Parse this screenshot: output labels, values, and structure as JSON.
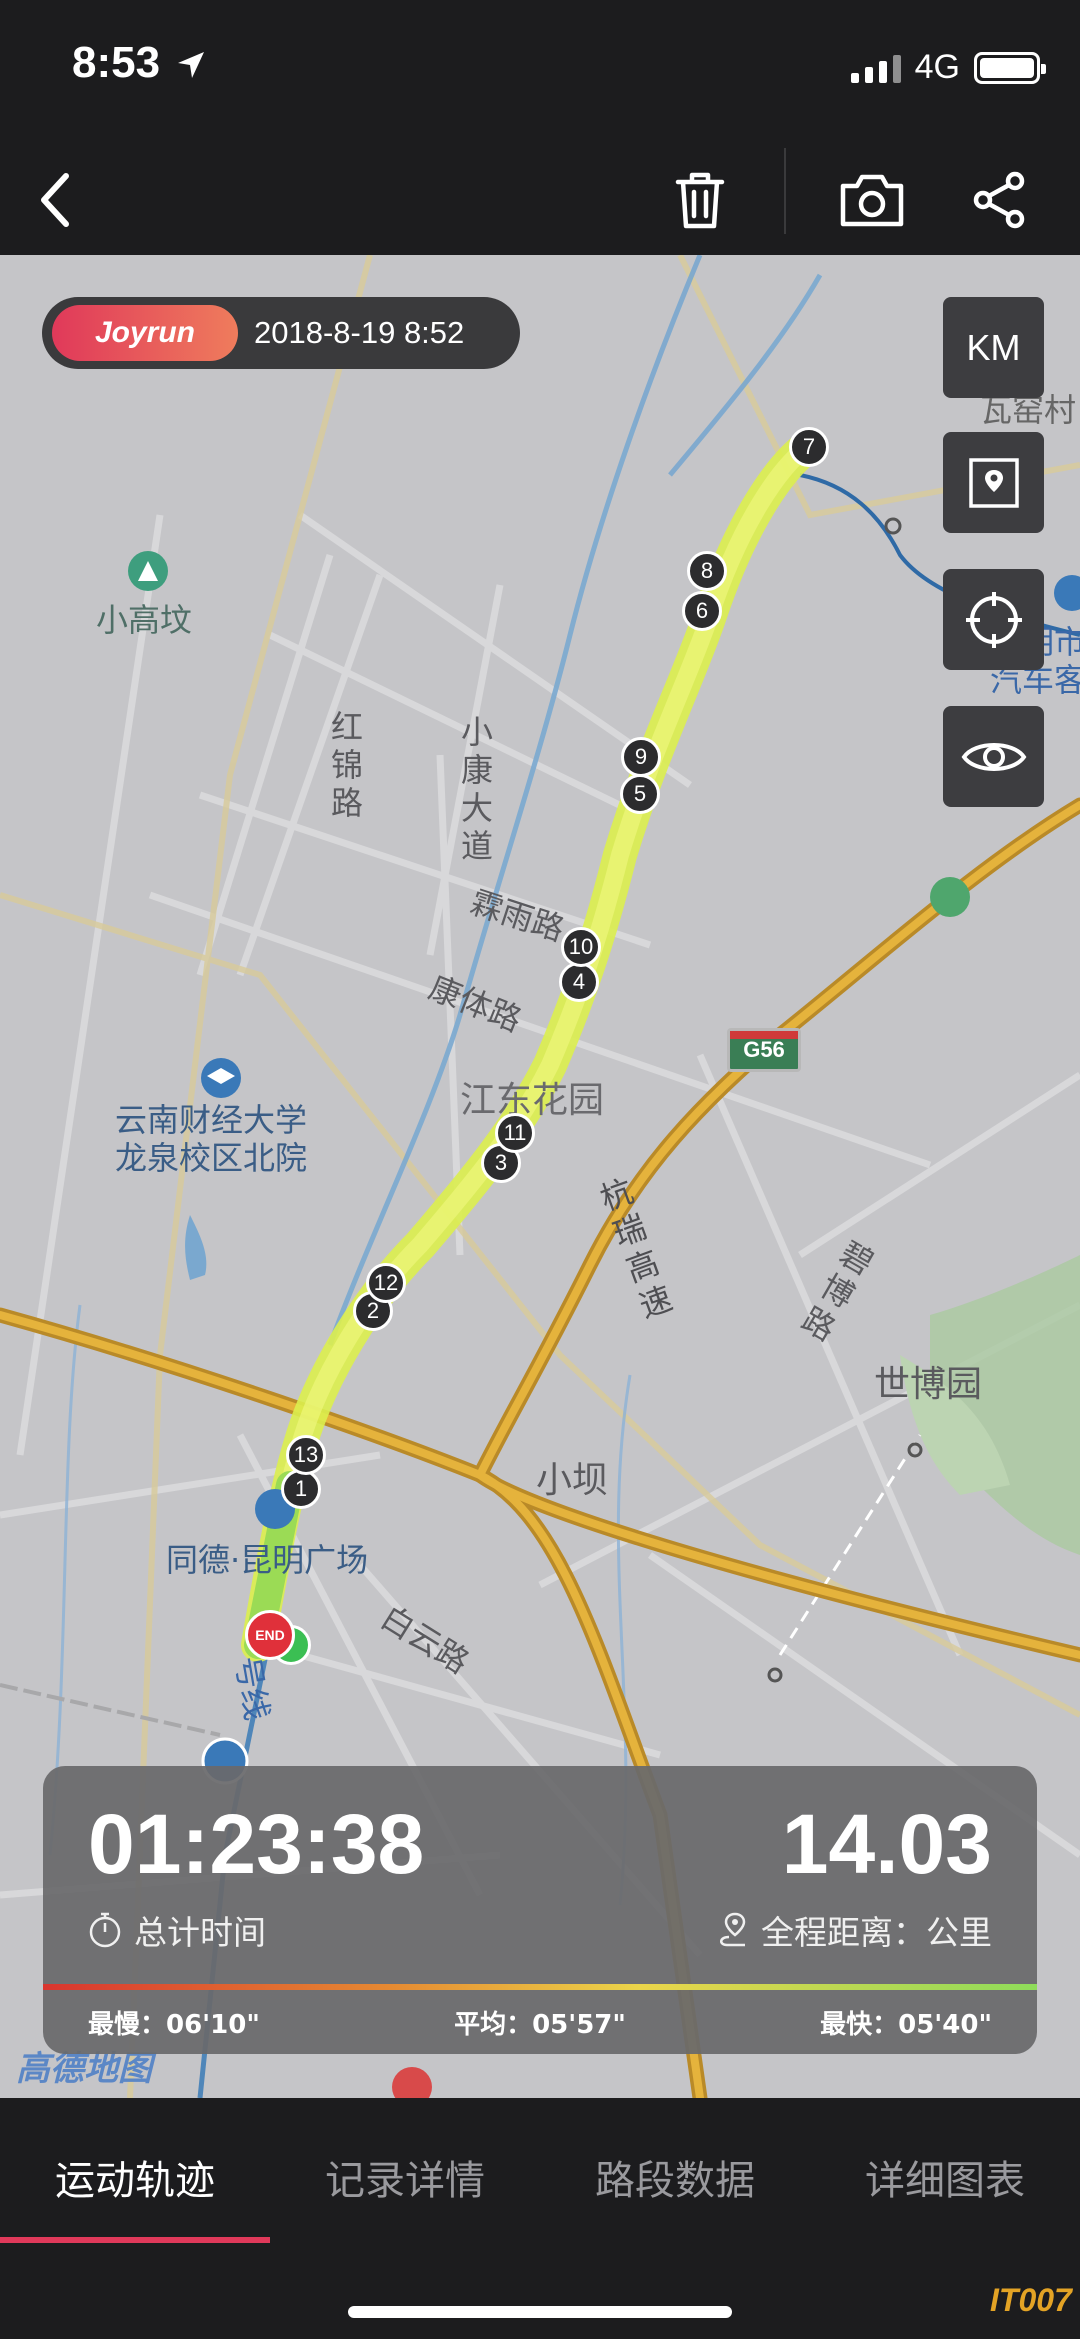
{
  "status_bar": {
    "time": "8:53",
    "network": "4G"
  },
  "nav": {
    "back_icon": "chevron-left-icon",
    "delete_icon": "trash-icon",
    "camera_icon": "camera-icon",
    "share_icon": "share-icon"
  },
  "map": {
    "brand": "Joyrun",
    "datetime": "2018-8-19 8:52",
    "unit_button": "KM",
    "labels": {
      "wayaocun": "瓦窑村",
      "kunming_station_1": "昆明市",
      "kunming_station_2": "汽车客",
      "xiaogaofen": "小高坟",
      "honglin_road": "红锦路",
      "xiaokang_avenue": "小康大道",
      "linyu_road": "霖雨路",
      "kangti_road": "康体路",
      "jiangdong_garden": "江东花园",
      "yncaijing_1": "云南财经大学",
      "yncaijing_2": "龙泉校区北院",
      "hangrui_highway": "杭瑞高速",
      "bibo_road": "碧博路",
      "shibo_park": "世博园",
      "xiaoba": "小坝",
      "tongde_plaza": "同德·昆明广场",
      "baiyun_road": "白云路",
      "line_label": "号线",
      "g56": "G56",
      "map_provider": "高德地图"
    },
    "markers": [
      "1",
      "2",
      "3",
      "4",
      "5",
      "6",
      "7",
      "8",
      "9",
      "10",
      "11",
      "12",
      "13"
    ],
    "end_label": "END",
    "colors": {
      "route": "#e6f55a",
      "highway": "#c9962b",
      "water": "#4f86b9",
      "accent": "#e0395a"
    }
  },
  "stats": {
    "total_time": "01:23:38",
    "total_time_label": "总计时间",
    "distance": "14.03",
    "distance_label": "全程距离：公里",
    "slowest": "最慢：06'10\"",
    "average": "平均：05'57\"",
    "fastest": "最快：05'40\""
  },
  "tabs": [
    {
      "label": "运动轨迹",
      "active": true
    },
    {
      "label": "记录详情",
      "active": false
    },
    {
      "label": "路段数据",
      "active": false
    },
    {
      "label": "详细图表",
      "active": false
    }
  ],
  "watermark": "IT007"
}
